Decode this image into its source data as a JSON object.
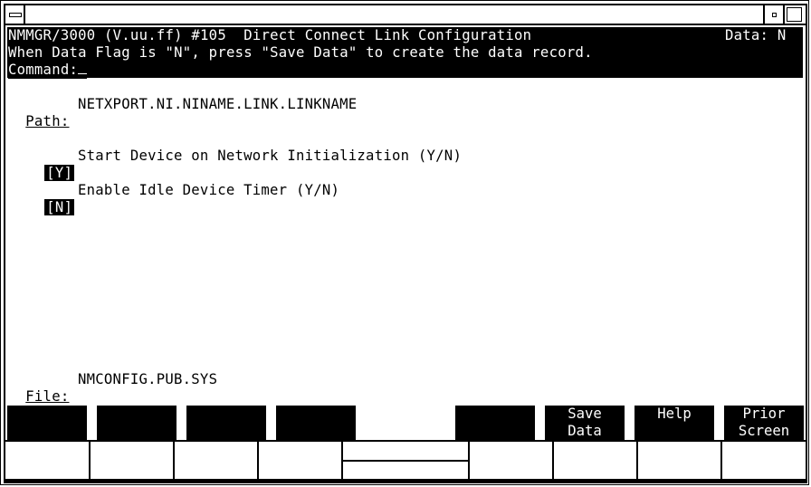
{
  "window": {
    "system_menu_icon": "system-menu-icon",
    "minimize_icon": "minimize-icon",
    "maximize_icon": "maximize-icon"
  },
  "header": {
    "title": "NMMGR/3000 (V.uu.ff) #105  Direct Connect Link Configuration",
    "data_flag_label": "Data:",
    "data_flag_value": "N",
    "instruction": "When Data Flag is \"N\", press \"Save Data\" to create the data record.",
    "command_label": "Command:",
    "command_value": ""
  },
  "path": {
    "label": "Path:",
    "value": "NETXPORT.NI.NINAME.LINK.LINKNAME"
  },
  "fields": [
    {
      "value": "Y",
      "label": "Start Device on Network Initialization (Y/N)"
    },
    {
      "value": "N",
      "label": "Enable Idle Device Timer (Y/N)"
    }
  ],
  "file": {
    "label": "File:",
    "value": "NMCONFIG.PUB.SYS"
  },
  "function_keys": [
    {
      "key": "f1",
      "label": ""
    },
    {
      "key": "f2",
      "label": ""
    },
    {
      "key": "f3",
      "label": ""
    },
    {
      "key": "f4",
      "label": ""
    },
    {
      "key": "f5",
      "label": ""
    },
    {
      "key": "f6",
      "label": "Save\nData"
    },
    {
      "key": "f7",
      "label": "Help"
    },
    {
      "key": "f8",
      "label": "Prior\nScreen"
    }
  ],
  "colors": {
    "background": "#ffffff",
    "foreground": "#000000",
    "inverse_background": "#000000",
    "inverse_foreground": "#ffffff"
  }
}
